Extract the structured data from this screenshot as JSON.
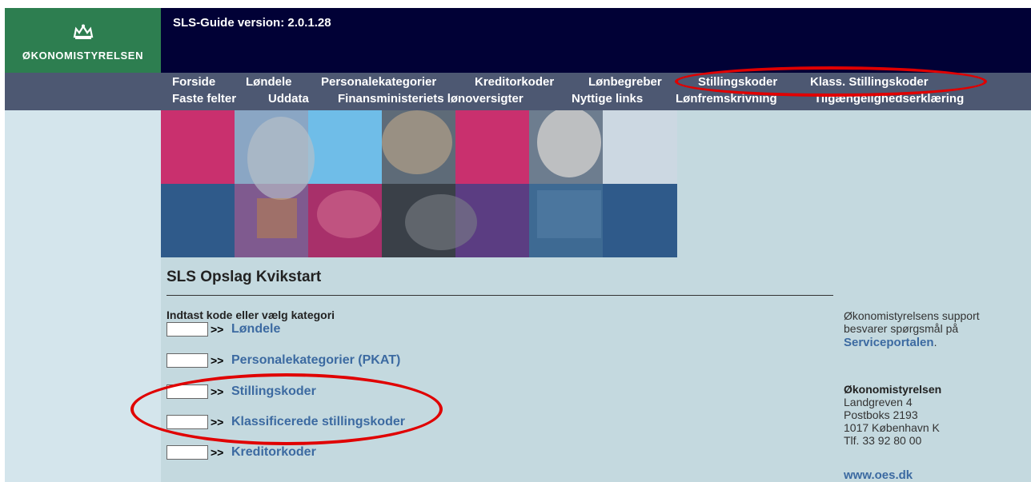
{
  "logo": {
    "text": "ØKONOMISTYRELSEN"
  },
  "header": {
    "version": "SLS-Guide version: 2.0.1.28"
  },
  "nav": {
    "row1": [
      "Forside",
      "Løndele",
      "Personalekategorier",
      "Kreditorkoder",
      "Lønbegreber",
      "Stillingskoder",
      "Klass. Stillingskoder"
    ],
    "row2": [
      "Faste felter",
      "Uddata",
      "Finansministeriets lønoversigter",
      "Nyttige links",
      "Lønfremskrivning",
      "Tilgængelighedserklæring"
    ]
  },
  "main": {
    "title": "SLS Opslag Kvikstart",
    "prompt": "Indtast kode eller vælg kategori",
    "arrow": ">>",
    "items": [
      {
        "label": "Løndele",
        "value": ""
      },
      {
        "label": "Personalekategorier (PKAT)",
        "value": ""
      },
      {
        "label": "Stillingskoder",
        "value": ""
      },
      {
        "label": "Klassificerede stillingskoder",
        "value": ""
      },
      {
        "label": "Kreditorkoder",
        "value": ""
      }
    ]
  },
  "sidebar": {
    "support_line1": "Økonomistyrelsens support",
    "support_line2": "besvarer spørgsmål på",
    "support_link": "Serviceportalen",
    "support_period": ".",
    "org_name": "Økonomistyrelsen",
    "address": [
      "Landgreven 4",
      "Postboks 2193",
      "1017 København K",
      "Tlf. 33 92 80 00"
    ],
    "website": "www.oes.dk"
  },
  "colors": {
    "logo_bg": "#2d7e50",
    "header_bg": "#010136",
    "nav_bg": "#4d5872",
    "main_bg": "#c4d9df",
    "link": "#3c6aa1",
    "highlight": "#e00000"
  }
}
